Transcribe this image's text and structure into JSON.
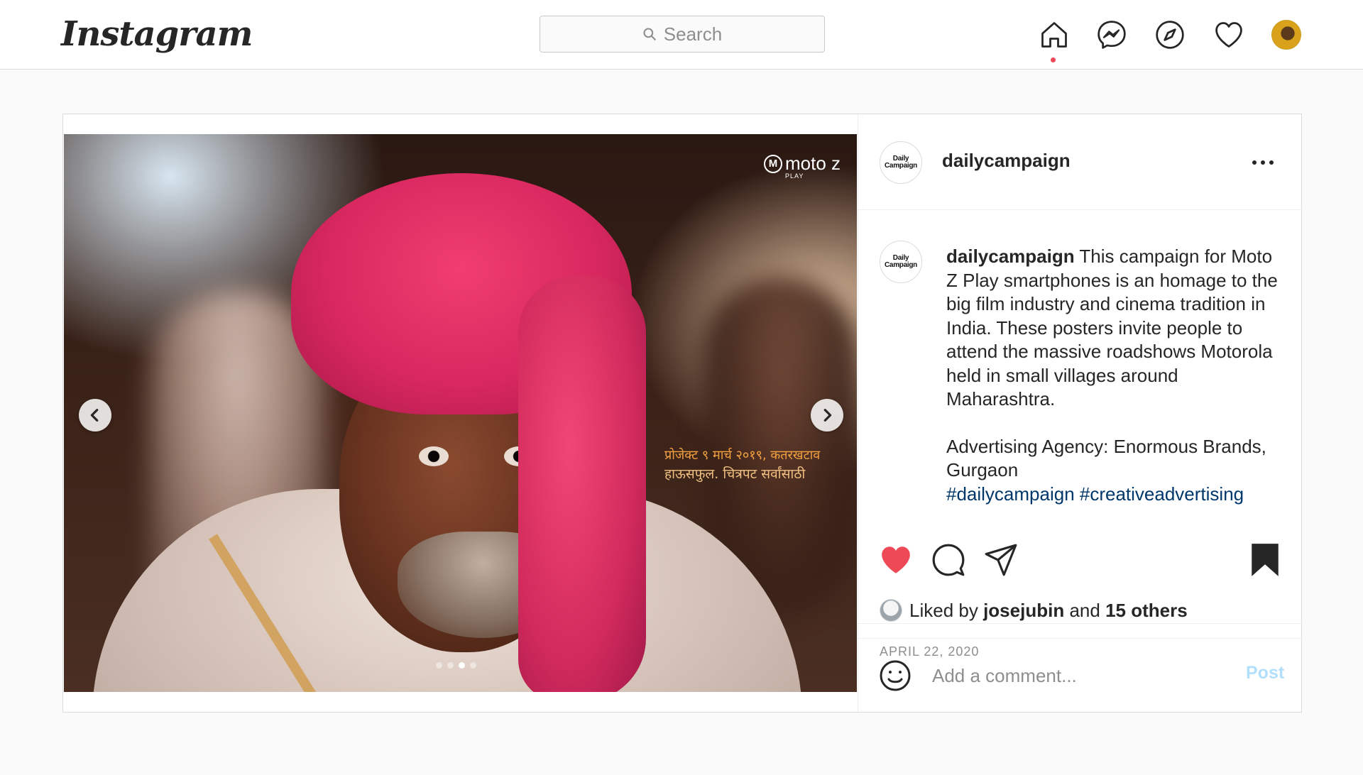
{
  "app": {
    "logo_text": "Instagram"
  },
  "search": {
    "placeholder": "Search"
  },
  "nav": {
    "icons": [
      "home-icon",
      "messenger-icon",
      "explore-icon",
      "heart-icon",
      "profile-avatar"
    ],
    "active": "home",
    "notification_dot_color": "#ed4956"
  },
  "post": {
    "author": "dailycampaign",
    "author_avatar_text": [
      "Daily",
      "Campaign"
    ],
    "media": {
      "brand_watermark": "moto z",
      "brand_watermark_sub": "PLAY",
      "overlay_line1": "प्रोजेक्ट  ९ मार्च २०१९, कतरखटाव",
      "overlay_line2": "हाऊसफुल.  चित्रपट सर्वांसाठी",
      "carousel_total": 4,
      "carousel_active": 3
    },
    "caption": {
      "username": "dailycampaign",
      "text": "This campaign for Moto Z Play smartphones is an homage to the big film industry and cinema tradition in India. These posters invite people to attend the massive roadshows Motorola held in small villages around Maharashtra.",
      "agency": "Advertising Agency: Enormous Brands, Gurgaon",
      "hashtags": "#dailycampaign #creativeadvertising"
    },
    "likes": {
      "prefix": "Liked by",
      "first_liker": "josejubin",
      "conjunction": "and",
      "others": "15 others"
    },
    "date": "APRIL 22, 2020",
    "liked": true,
    "saved": true,
    "like_color": "#ed4956",
    "comment": {
      "placeholder": "Add a comment...",
      "post_label": "Post",
      "post_color": "#b2dffc"
    }
  }
}
